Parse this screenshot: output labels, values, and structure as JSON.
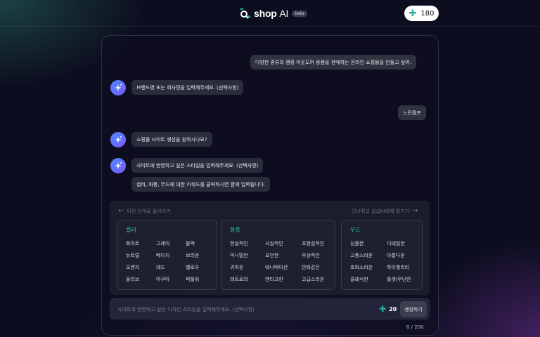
{
  "header": {
    "logo_brand": "shop",
    "logo_ai": "AI",
    "beta": "beta",
    "credits": "180"
  },
  "messages": [
    {
      "role": "user",
      "text": "다양한 종류의 캠핑 아웃도어 용품을 판매하는 온라인 쇼핑몰을 만들고 싶어."
    },
    {
      "role": "bot",
      "text": "브랜드명 또는 회사명을 입력해주세요. (선택사항)"
    },
    {
      "role": "user",
      "text": "느린캠프"
    },
    {
      "role": "bot",
      "text": "쇼핑몰 사이트 생성을 원하시나요?"
    },
    {
      "role": "bot",
      "text": "사이트에 반영하고 싶은 스타일을 입력해주세요. (선택사항)"
    },
    {
      "role": "bot",
      "text": "컬러, 화풍, 무드에 대한 키워드를 클릭하시면 함께 입력됩니다."
    }
  ],
  "options": {
    "back_label": "이전 단계로 돌아가기",
    "skip_label": "건너뛰고 쉽샵AI에게 맡기기",
    "groups": [
      {
        "title": "컬러",
        "keywords": [
          "화이트",
          "그레이",
          "블랙",
          "뉴트럴",
          "베이지",
          "브라운",
          "오렌지",
          "레드",
          "옐로우",
          "올리브",
          "아쿠아",
          "퍼플쉬"
        ]
      },
      {
        "title": "화풍",
        "keywords": [
          "현실적인",
          "사실적인",
          "초현실적인",
          "미니멀한",
          "모던한",
          "추상적인",
          "귀여운",
          "애니메이션",
          "만화같은",
          "레트로의",
          "앤티크한",
          "고급스러운"
        ]
      },
      {
        "title": "무드",
        "keywords": [
          "심플한",
          "디테일한",
          "고풍스러운",
          "아름다운",
          "호화스러운",
          "하이퀄리티",
          "클래식한",
          "플랫/무난한"
        ]
      }
    ]
  },
  "composer": {
    "placeholder": "사이트에 반영하고 싶은 디자인 스타일을 입력해주세요. (선택사항)",
    "cost": "20",
    "generate_label": "생성하기",
    "counter": "0 / 200"
  },
  "colors": {
    "accent": "#33c4a6",
    "background": "#0c0d1e"
  }
}
